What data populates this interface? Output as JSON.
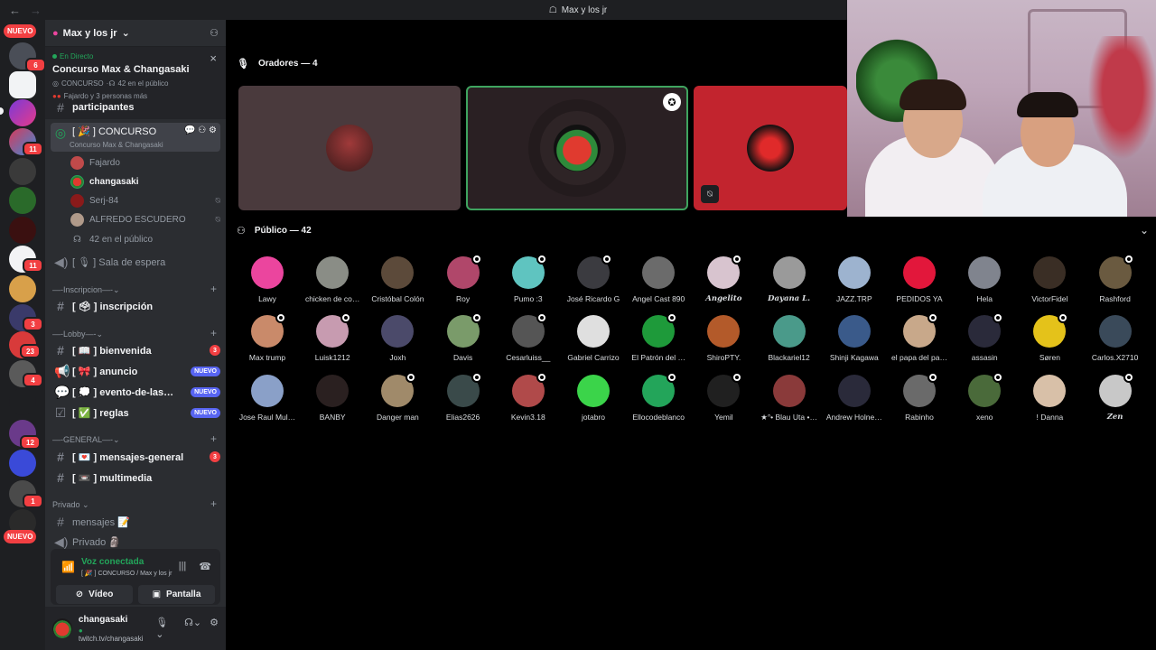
{
  "titlebar": {
    "title": "Max y los jr",
    "back": "←",
    "forward": "→"
  },
  "rail": {
    "nuevo_top": "NUEVO",
    "nuevo_bottom": "NUEVO",
    "badges": [
      "6",
      "11",
      "11",
      "3",
      "23",
      "4",
      "12",
      "1",
      "1"
    ]
  },
  "guild": {
    "name": "Max y los jr"
  },
  "stage": {
    "live": "En Directo",
    "title": "Concurso Max & Changasaki",
    "channel": "CONCURSO",
    "audience": "42 en el público",
    "speakers": "Fajardo y 3 personas más"
  },
  "channels": {
    "partial": "participantes",
    "concurso": "CONCURSO",
    "concurso_sub": "Concurso Max & Changasaki",
    "members": [
      "Fajardo",
      "changasaki",
      "Serj-84",
      "ALFREDO ESCUDERO"
    ],
    "audience": "42 en el público",
    "waiting": "Sala de espera",
    "cat_inscripcion": "—-Inscripcion—-",
    "inscripcion": "inscripción",
    "cat_lobby": "—-Lobby—-",
    "bienvenida": "bienvenida",
    "bienvenida_count": "3",
    "anuncio": "anuncio",
    "evento": "evento-de-las…",
    "reglas": "reglas",
    "nuevo": "NUEVO",
    "cat_general": "—-GENERAL—-",
    "mensajes_general": "mensajes-general",
    "mensajes_count": "3",
    "multimedia": "multimedia",
    "cat_privado": "Privado",
    "mensajes": "mensajes 📝",
    "privado": "Privado 🗿"
  },
  "voice": {
    "status": "Voz conectada",
    "sub": "CONCURSO / Max y los jr",
    "video": "Vídeo",
    "screen": "Pantalla"
  },
  "user": {
    "name": "changasaki",
    "status": "twitch.tv/changasaki"
  },
  "main": {
    "speakers_header": "Oradores — 4",
    "audience_header": "Público — 42"
  },
  "audience": [
    {
      "name": "Lawy",
      "color": "#eb459e",
      "mod": false
    },
    {
      "name": "chicken de co…",
      "color": "#8a8d86",
      "mod": false
    },
    {
      "name": "Cristóbal Colón",
      "color": "#5c4a3a",
      "mod": false
    },
    {
      "name": "Roy",
      "color": "#b0476a",
      "mod": true
    },
    {
      "name": "Pumo :3",
      "color": "#5fc4c0",
      "mod": true
    },
    {
      "name": "José Ricardo G",
      "color": "#3b3b40",
      "mod": true
    },
    {
      "name": "Angel Cast 890",
      "color": "#6b6b6b",
      "mod": false
    },
    {
      "name": "Angelito",
      "color": "#d8c4cf",
      "mod": true
    },
    {
      "name": "Dayana L.",
      "color": "#9a9a9a",
      "mod": false
    },
    {
      "name": "JAZZ.TRP",
      "color": "#9db3cf",
      "mod": false
    },
    {
      "name": "PEDIDOS YA",
      "color": "#e2173b",
      "mod": false
    },
    {
      "name": "Hela",
      "color": "#80848e",
      "mod": false
    },
    {
      "name": "VictorFidel",
      "color": "#3a2e25",
      "mod": false
    },
    {
      "name": "Rashford",
      "color": "#6a5a40",
      "mod": true
    },
    {
      "name": "Max trump",
      "color": "#c98a6a",
      "mod": true
    },
    {
      "name": "Luisk1212",
      "color": "#c79bb0",
      "mod": true
    },
    {
      "name": "Joxh",
      "color": "#4b4a6a",
      "mod": false
    },
    {
      "name": "Davis",
      "color": "#7a9b6a",
      "mod": true
    },
    {
      "name": "Cesarluiss__",
      "color": "#555555",
      "mod": true
    },
    {
      "name": "Gabriel Carrizo",
      "color": "#dfdfdf",
      "mod": false
    },
    {
      "name": "El Patrón del …",
      "color": "#1e9a3a",
      "mod": true
    },
    {
      "name": "ShiroPTY.",
      "color": "#b35a2a",
      "mod": false
    },
    {
      "name": "Blackariel12",
      "color": "#4a9a8a",
      "mod": false
    },
    {
      "name": "Shinji Kagawa",
      "color": "#3a5a8a",
      "mod": false
    },
    {
      "name": "el papa del pa…",
      "color": "#c8a88a",
      "mod": true
    },
    {
      "name": "assasin",
      "color": "#2a2a3a",
      "mod": true
    },
    {
      "name": "Søren",
      "color": "#e4c21a",
      "mod": true
    },
    {
      "name": "Carlos.X2710",
      "color": "#3a4a5a",
      "mod": false
    },
    {
      "name": "Jose Raul Mul…",
      "color": "#8aa0c8",
      "mod": false
    },
    {
      "name": "BANBY",
      "color": "#2a2020",
      "mod": false
    },
    {
      "name": "Danger man",
      "color": "#a08a6a",
      "mod": true
    },
    {
      "name": "Elias2626",
      "color": "#3a4a4a",
      "mod": true
    },
    {
      "name": "Kevin3.18",
      "color": "#b04a4a",
      "mod": true
    },
    {
      "name": "jotabro",
      "color": "#3bd44a",
      "mod": false
    },
    {
      "name": "Ellocodeblanco",
      "color": "#23a55a",
      "mod": true
    },
    {
      "name": "Yemil",
      "color": "#202020",
      "mod": true
    },
    {
      "name": "★ᐢ• Blau Uta •…",
      "color": "#8a3a3a",
      "mod": false
    },
    {
      "name": "Andrew Holne…",
      "color": "#2a2a3a",
      "mod": false
    },
    {
      "name": "Rabinho",
      "color": "#6a6a6a",
      "mod": true
    },
    {
      "name": "xeno",
      "color": "#4a6a3a",
      "mod": true
    },
    {
      "name": "! Danna",
      "color": "#d8c0a8",
      "mod": false
    },
    {
      "name": "Zen",
      "color": "#c8c8c8",
      "mod": true
    }
  ]
}
